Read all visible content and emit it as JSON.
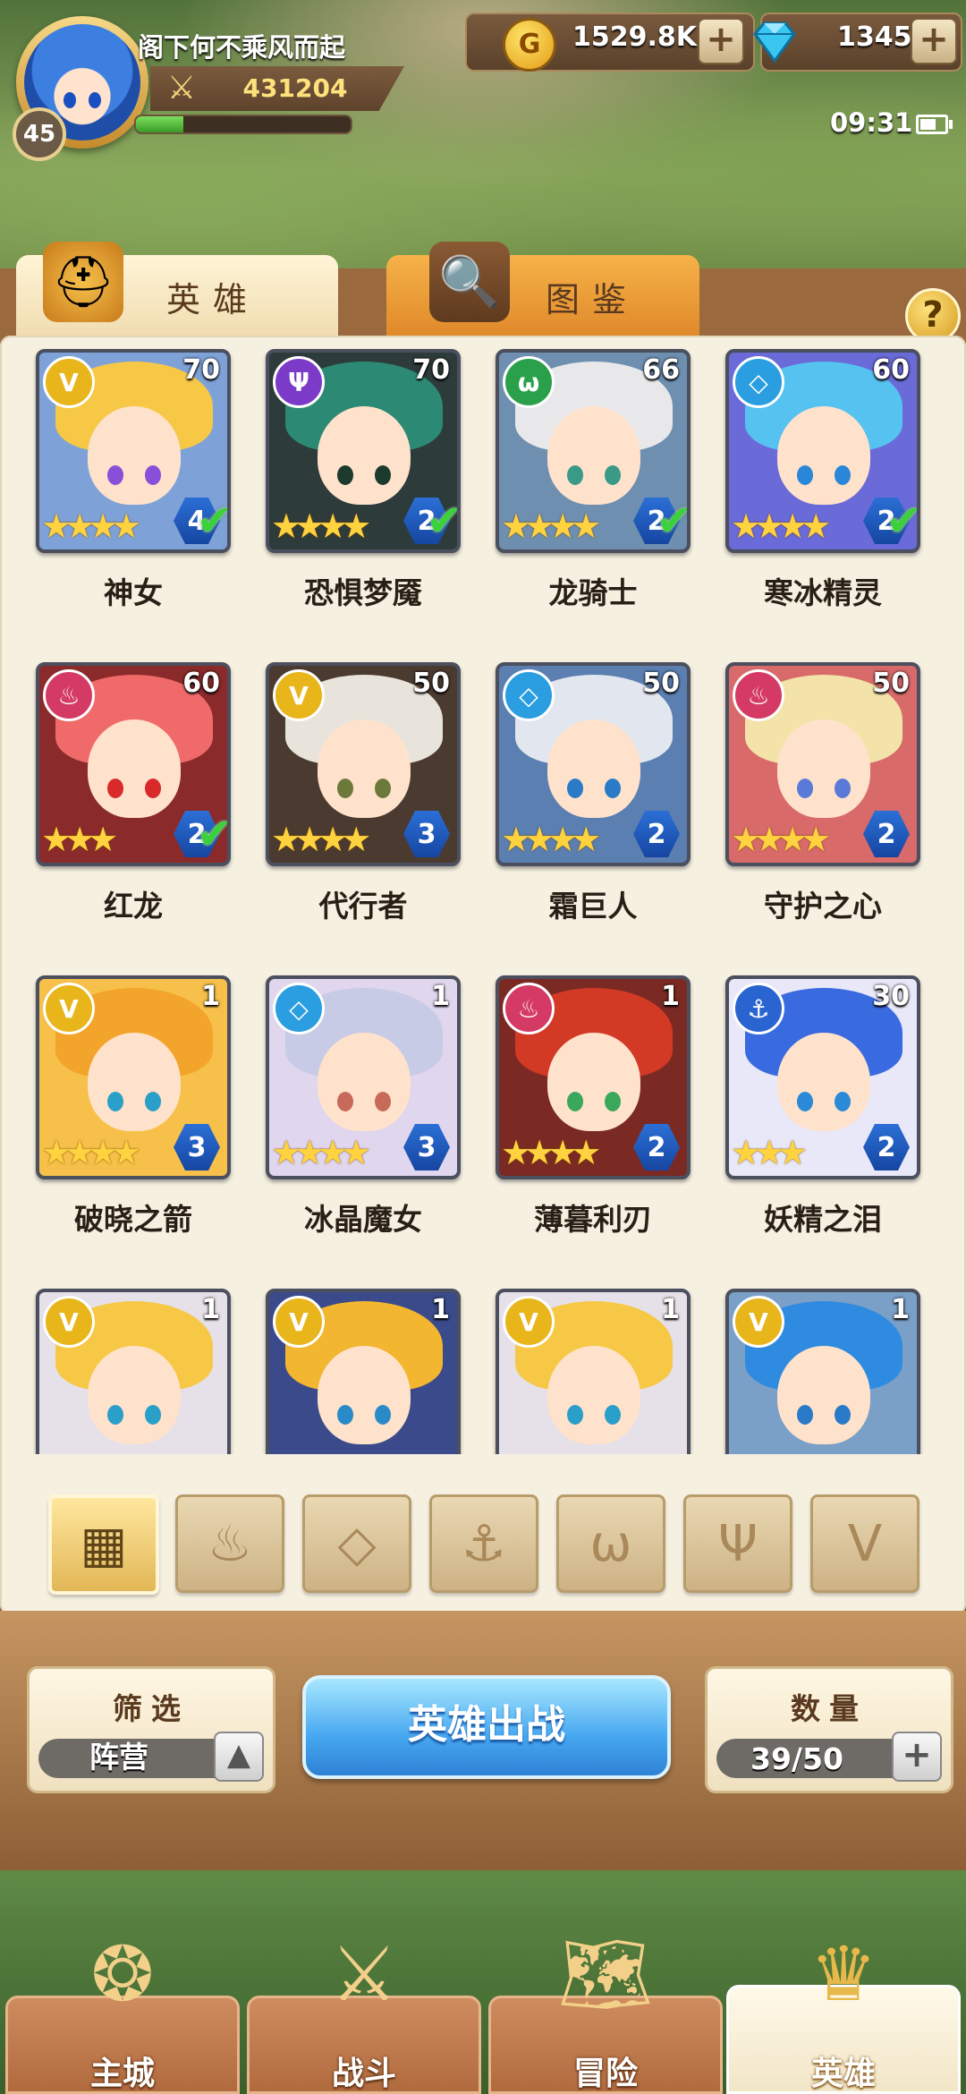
{
  "player": {
    "name": "阁下何不乘风而起",
    "level": "45",
    "power": "431204",
    "exp_fraction": 0.22
  },
  "resources": {
    "coins": "1529.8K",
    "gems": "1345",
    "coin_symbol": "G"
  },
  "status": {
    "time": "09:31",
    "battery_fraction": 0.7
  },
  "tabs": [
    {
      "label": "英雄",
      "icon": "knight-helmet-icon",
      "active": true
    },
    {
      "label": "图鉴",
      "icon": "magnifier-book-icon",
      "active": false
    }
  ],
  "help_label": "?",
  "heroes": [
    {
      "name": "神女",
      "level": "70",
      "faction": "light",
      "grade": "4",
      "deployed": true,
      "stars": 4,
      "colors": {
        "hair": "#f6c846",
        "eye": "#8a4fd8",
        "bg": "#7ea2d8"
      }
    },
    {
      "name": "恐惧梦魇",
      "level": "70",
      "faction": "dark",
      "grade": "2",
      "deployed": true,
      "stars": 4,
      "colors": {
        "hair": "#2c8a74",
        "eye": "#1c3a2e",
        "bg": "#2d3b3a"
      }
    },
    {
      "name": "龙骑士",
      "level": "66",
      "faction": "beast",
      "grade": "2",
      "deployed": true,
      "stars": 4,
      "colors": {
        "hair": "#e8e8ea",
        "eye": "#3a9a88",
        "bg": "#6e8fb0"
      }
    },
    {
      "name": "寒冰精灵",
      "level": "60",
      "faction": "water",
      "grade": "2",
      "deployed": true,
      "stars": 4,
      "colors": {
        "hair": "#55c2f0",
        "eye": "#2a86d8",
        "bg": "#6a6ad8"
      }
    },
    {
      "name": "红龙",
      "level": "60",
      "faction": "fire",
      "grade": "2",
      "deployed": true,
      "stars": 3,
      "colors": {
        "hair": "#f06a6a",
        "eye": "#d82a2a",
        "bg": "#8a2a2a"
      }
    },
    {
      "name": "代行者",
      "level": "50",
      "faction": "light",
      "grade": "3",
      "deployed": false,
      "stars": 4,
      "colors": {
        "hair": "#e8e4dc",
        "eye": "#6b7a3a",
        "bg": "#4a3a30"
      }
    },
    {
      "name": "霜巨人",
      "level": "50",
      "faction": "water",
      "grade": "2",
      "deployed": false,
      "stars": 4,
      "colors": {
        "hair": "#e2e6ee",
        "eye": "#2a7ac8",
        "bg": "#5a7fb0"
      }
    },
    {
      "name": "守护之心",
      "level": "50",
      "faction": "fire",
      "grade": "2",
      "deployed": false,
      "stars": 4,
      "colors": {
        "hair": "#f3e3a8",
        "eye": "#5a7ad8",
        "bg": "#d86a6a"
      }
    },
    {
      "name": "破晓之箭",
      "level": "1",
      "faction": "light",
      "grade": "3",
      "deployed": false,
      "stars": 4,
      "colors": {
        "hair": "#f2a52a",
        "eye": "#2aa0c8",
        "bg": "#f6c04a"
      }
    },
    {
      "name": "冰晶魔女",
      "level": "1",
      "faction": "water",
      "grade": "3",
      "deployed": false,
      "stars": 4,
      "colors": {
        "hair": "#c8cbe6",
        "eye": "#c86a5a",
        "bg": "#e0d6ee"
      }
    },
    {
      "name": "薄暮利刃",
      "level": "1",
      "faction": "fire",
      "grade": "2",
      "deployed": false,
      "stars": 4,
      "colors": {
        "hair": "#d23a26",
        "eye": "#3aa85a",
        "bg": "#7a2a22"
      }
    },
    {
      "name": "妖精之泪",
      "level": "30",
      "faction": "anchor",
      "grade": "2",
      "deployed": false,
      "stars": 3,
      "colors": {
        "hair": "#3a6ae0",
        "eye": "#2a8ad8",
        "bg": "#e8e8f8"
      }
    },
    {
      "name": "",
      "level": "1",
      "faction": "light",
      "grade": "",
      "deployed": false,
      "stars": 0,
      "colors": {
        "hair": "#f6c846",
        "eye": "#2aa0c8",
        "bg": "#e6e0e8"
      }
    },
    {
      "name": "",
      "level": "1",
      "faction": "light",
      "grade": "",
      "deployed": false,
      "stars": 0,
      "colors": {
        "hair": "#f2b630",
        "eye": "#2a8ac8",
        "bg": "#3a4a8a"
      }
    },
    {
      "name": "",
      "level": "1",
      "faction": "light",
      "grade": "",
      "deployed": false,
      "stars": 0,
      "colors": {
        "hair": "#f6c846",
        "eye": "#2aa0c8",
        "bg": "#e6e0e8"
      }
    },
    {
      "name": "",
      "level": "1",
      "faction": "light",
      "grade": "",
      "deployed": false,
      "stars": 0,
      "colors": {
        "hair": "#2f8be0",
        "eye": "#2a7ac8",
        "bg": "#7aa0c8"
      }
    }
  ],
  "faction_styles": {
    "light": {
      "color": "#e8b51a",
      "glyph": "V",
      "icon": "light-faction-icon"
    },
    "dark": {
      "color": "#7b3bc8",
      "glyph": "Ψ",
      "icon": "dark-faction-icon"
    },
    "beast": {
      "color": "#2aa04a",
      "glyph": "ω",
      "icon": "beast-faction-icon"
    },
    "water": {
      "color": "#2a9ee0",
      "glyph": "◇",
      "icon": "water-faction-icon"
    },
    "fire": {
      "color": "#d43a64",
      "glyph": "♨",
      "icon": "fire-faction-icon"
    },
    "anchor": {
      "color": "#2a64d0",
      "glyph": "⚓",
      "icon": "anchor-faction-icon"
    }
  },
  "filters": [
    {
      "icon": "all-grid-icon",
      "glyph": "▦",
      "active": true
    },
    {
      "icon": "fire-filter-icon",
      "glyph": "♨",
      "active": false
    },
    {
      "icon": "water-filter-icon",
      "glyph": "◇",
      "active": false
    },
    {
      "icon": "anchor-filter-icon",
      "glyph": "⚓",
      "active": false
    },
    {
      "icon": "beast-filter-icon",
      "glyph": "ω",
      "active": false
    },
    {
      "icon": "dark-filter-icon",
      "glyph": "Ψ",
      "active": false
    },
    {
      "icon": "light-filter-icon",
      "glyph": "V",
      "active": false
    }
  ],
  "controls": {
    "filter_title": "筛选",
    "filter_value": "阵营",
    "deploy_label": "英雄出战",
    "count_title": "数量",
    "count_value": "39/50",
    "sort_glyph": "▲",
    "plus_glyph": "+"
  },
  "nav": [
    {
      "label": "主城",
      "icon": "city-crystal-icon",
      "glyph": "❂",
      "active": false
    },
    {
      "label": "战斗",
      "icon": "crossed-swords-icon",
      "glyph": "⚔",
      "active": false
    },
    {
      "label": "冒险",
      "icon": "map-scroll-icon",
      "glyph": "🗺",
      "active": false
    },
    {
      "label": "英雄",
      "icon": "hero-helmet-icon",
      "glyph": "♛",
      "active": true
    }
  ]
}
